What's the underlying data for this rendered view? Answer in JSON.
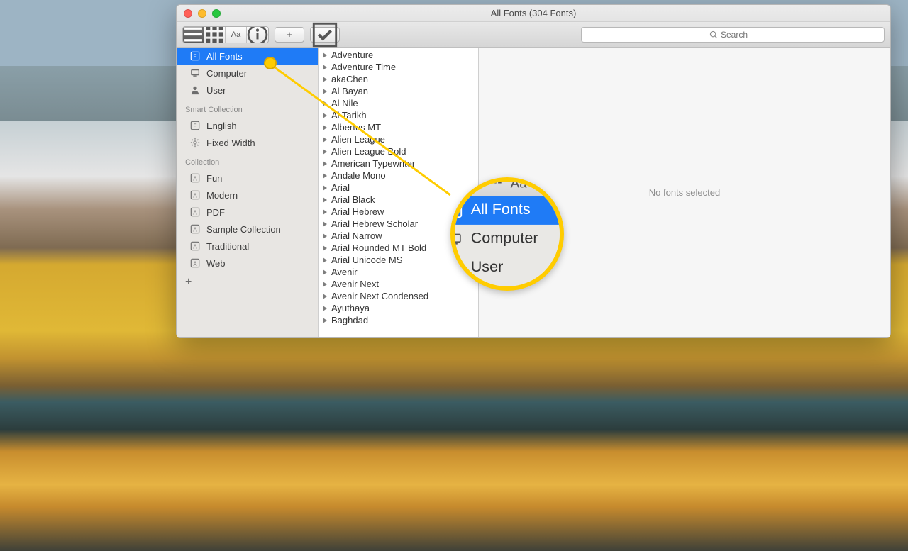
{
  "window": {
    "title": "All Fonts (304 Fonts)"
  },
  "toolbar": {
    "view_list_label": "≡",
    "view_grid_label": "⊞",
    "view_sample_label": "Aa",
    "info_label": "ⓘ",
    "add_label": "+",
    "validate_label": "☑",
    "search_placeholder": "Search",
    "search_icon": "search-icon"
  },
  "sidebar": {
    "default_items": [
      {
        "label": "All Fonts",
        "icon": "font-collection-icon",
        "selected": true
      },
      {
        "label": "Computer",
        "icon": "computer-icon",
        "selected": false
      },
      {
        "label": "User",
        "icon": "user-icon",
        "selected": false
      }
    ],
    "smart_header": "Smart Collection",
    "smart_items": [
      {
        "label": "English",
        "icon": "font-collection-icon"
      },
      {
        "label": "Fixed Width",
        "icon": "gear-icon"
      }
    ],
    "collection_header": "Collection",
    "collection_items": [
      {
        "label": "Fun",
        "icon": "box-a-icon"
      },
      {
        "label": "Modern",
        "icon": "box-a-icon"
      },
      {
        "label": "PDF",
        "icon": "box-a-icon"
      },
      {
        "label": "Sample Collection",
        "icon": "box-a-icon"
      },
      {
        "label": "Traditional",
        "icon": "box-a-icon"
      },
      {
        "label": "Web",
        "icon": "box-a-icon"
      }
    ],
    "add_label": "+"
  },
  "fonts": [
    "Adventure",
    "Adventure Time",
    "akaChen",
    "Al Bayan",
    "Al Nile",
    "Al Tarikh",
    "Albertus MT",
    "Alien League",
    "Alien League Bold",
    "American Typewriter",
    "Andale Mono",
    "Arial",
    "Arial Black",
    "Arial Hebrew",
    "Arial Hebrew Scholar",
    "Arial Narrow",
    "Arial Rounded MT Bold",
    "Arial Unicode MS",
    "Avenir",
    "Avenir Next",
    "Avenir Next Condensed",
    "Ayuthaya",
    "Baghdad"
  ],
  "preview": {
    "empty_text": "No fonts selected"
  },
  "callout": {
    "toolbar_grid": "⊞",
    "toolbar_sample": "Aa",
    "row1": "All Fonts",
    "row2": "Computer",
    "row3": "User"
  }
}
